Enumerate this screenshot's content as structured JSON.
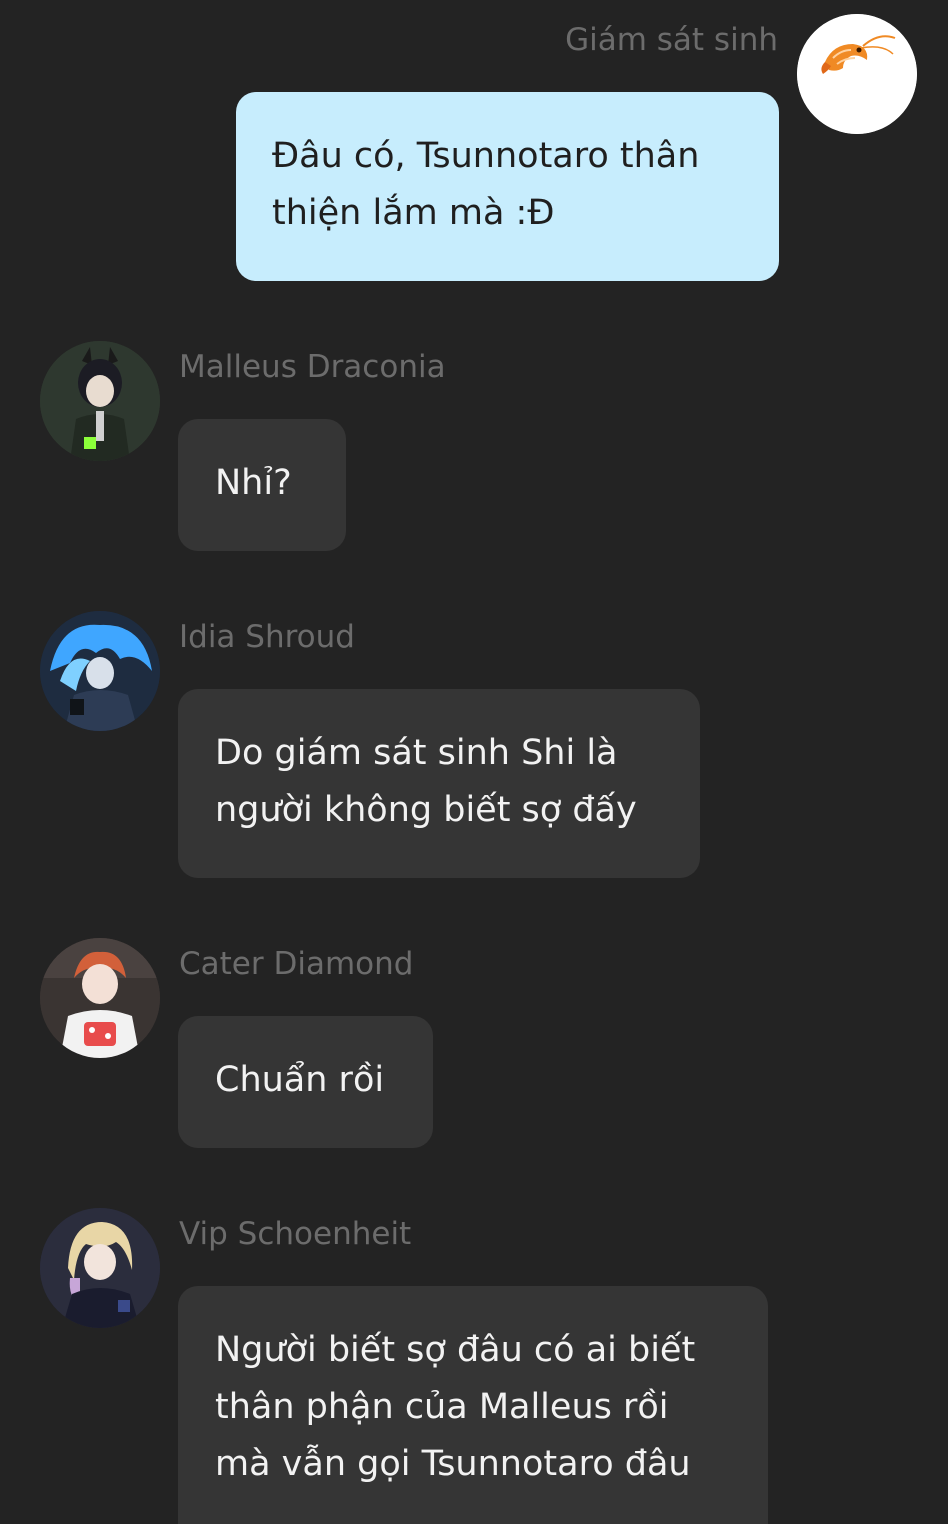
{
  "chat": {
    "messages": [
      {
        "sender": "Giám sát sinh",
        "direction": "outgoing",
        "avatar_icon": "shrimp-icon",
        "lines": [
          "Đâu có, Tsunnotaro thân",
          "thiện lắm mà :Đ"
        ]
      },
      {
        "sender": "Malleus Draconia",
        "direction": "incoming",
        "avatar_icon": "horned-character-avatar",
        "lines": [
          "Nhỉ?"
        ]
      },
      {
        "sender": "Idia Shroud",
        "direction": "incoming",
        "avatar_icon": "blue-flame-hair-character-avatar",
        "lines": [
          "Do giám sát sinh Shi là",
          "người không biết sợ đấy"
        ]
      },
      {
        "sender": "Cater Diamond",
        "direction": "incoming",
        "avatar_icon": "orange-hair-character-avatar",
        "lines": [
          "Chuẩn rồi"
        ]
      },
      {
        "sender": "Vip Schoenheit",
        "direction": "incoming",
        "avatar_icon": "blonde-hair-character-avatar",
        "lines": [
          "Người biết sợ đâu có ai biết",
          "thân phận của Malleus rồi",
          "mà vẫn gọi Tsunnotaro đâu"
        ]
      }
    ]
  },
  "colors": {
    "background": "#232323",
    "incoming_bubble": "#353535",
    "outgoing_bubble": "#c7edfd",
    "name_text": "#6c6c6c"
  }
}
